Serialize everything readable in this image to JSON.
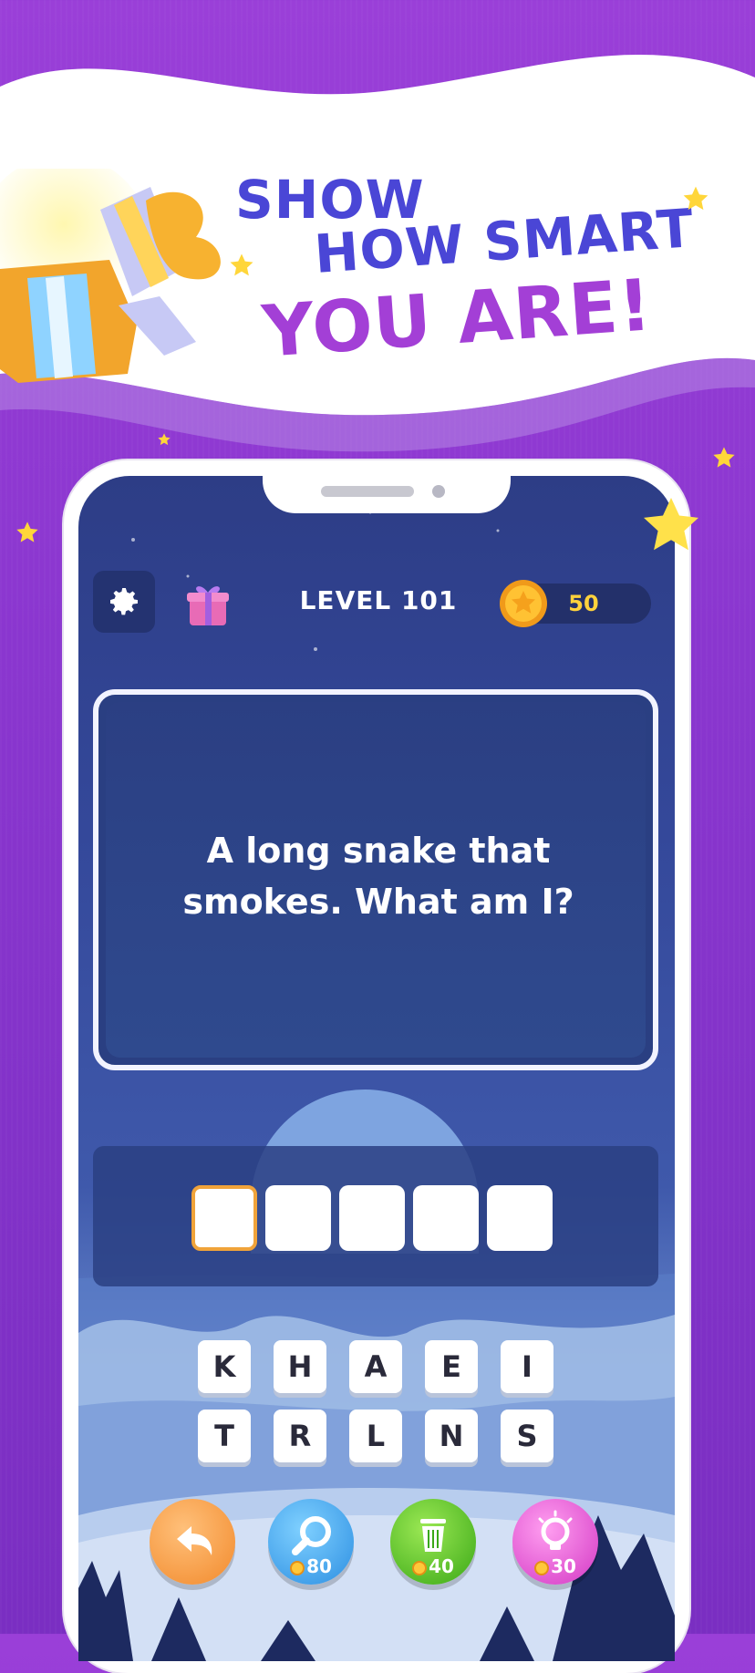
{
  "banner": {
    "line1": "SHOW",
    "line2": "HOW SMART",
    "line3": "YOU ARE!"
  },
  "topbar": {
    "level_label": "LEVEL 101",
    "coins": "50"
  },
  "question": {
    "text": "A long snake that smokes. What am I?"
  },
  "answer": {
    "slots": [
      "",
      "",
      "",
      "",
      ""
    ],
    "active_slot": 0
  },
  "letters": {
    "row1": [
      "K",
      "H",
      "A",
      "E",
      "I"
    ],
    "row2": [
      "T",
      "R",
      "L",
      "N",
      "S"
    ]
  },
  "actions": {
    "undo_icon": "undo-arrow-icon",
    "search_cost": "80",
    "delete_cost": "40",
    "hint_cost": "30"
  },
  "colors": {
    "background": "#8a36cf",
    "headline_blue": "#4a46d6",
    "headline_purple": "#a33fd6",
    "coin_text": "#ffd23c",
    "undo": "#f59a3c",
    "search": "#2d9be8",
    "delete": "#4fc21e",
    "hint": "#e04bd0"
  }
}
